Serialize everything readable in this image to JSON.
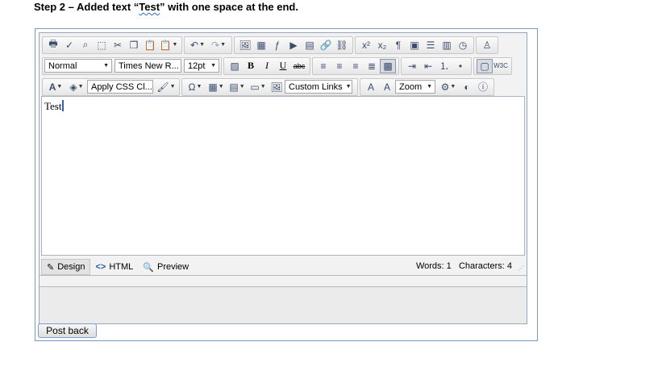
{
  "heading": {
    "prefix": "Step 2 – Added text “",
    "quoted": "Test",
    "suffix": "” with one space at the end."
  },
  "toolbar": {
    "row1": [
      "print-icon",
      "spellcheck-icon",
      "find-icon",
      "select-all-icon",
      "cut-icon",
      "copy-icon",
      "paste-icon",
      "paste-options-icon",
      "undo-icon",
      "redo-icon",
      "image-manager-icon",
      "image-map-icon",
      "flash-icon",
      "media-icon",
      "document-manager-icon",
      "hyperlink-manager-icon",
      "remove-link-icon",
      "superscript-icon",
      "subscript-icon",
      "paragraph-icon",
      "new-paragraph-icon",
      "horizontal-rule-icon",
      "format-code-icon",
      "insert-date-icon",
      "template-icon"
    ],
    "paragraph_style": "Normal",
    "font_name": "Times New R...",
    "font_size": "12pt",
    "bold_label": "B",
    "italic_label": "I",
    "underline_label": "U",
    "strike_label": "abc",
    "css_class": "Apply CSS Cl...",
    "omega_label": "Ω",
    "custom_links": "Custom Links",
    "zoom": "Zoom"
  },
  "content": {
    "text": "Test"
  },
  "modes": {
    "design": "Design",
    "html": "HTML",
    "preview": "Preview"
  },
  "stats": {
    "words_label": "Words:",
    "words": "1",
    "chars_label": "Characters:",
    "chars": "4"
  },
  "post_back_label": "Post back",
  "colors": {
    "border": "#7a99c2",
    "caret": "#2c5fd6"
  }
}
